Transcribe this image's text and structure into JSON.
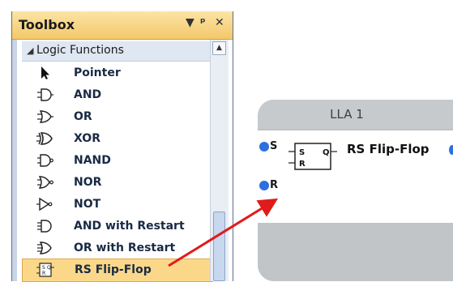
{
  "toolbox": {
    "title": "Toolbox",
    "dropdown_glyph": "▼",
    "pin_glyph": "ᵖ",
    "close_glyph": "✕",
    "category": "Logic Functions",
    "items": [
      {
        "label": "Pointer",
        "icon": "pointer-icon"
      },
      {
        "label": "AND",
        "icon": "and-gate-icon"
      },
      {
        "label": "OR",
        "icon": "or-gate-icon"
      },
      {
        "label": "XOR",
        "icon": "xor-gate-icon"
      },
      {
        "label": "NAND",
        "icon": "nand-gate-icon"
      },
      {
        "label": "NOR",
        "icon": "nor-gate-icon"
      },
      {
        "label": "NOT",
        "icon": "not-gate-icon"
      },
      {
        "label": "AND with Restart",
        "icon": "and-restart-icon"
      },
      {
        "label": "OR with Restart",
        "icon": "or-restart-icon"
      },
      {
        "label": "RS Flip-Flop",
        "icon": "rs-flipflop-icon",
        "selected": true
      }
    ]
  },
  "lla": {
    "title": "LLA 1",
    "ports": [
      "S",
      "R"
    ],
    "block_label": "RS Flip-Flop",
    "box_s": "S",
    "box_r": "R",
    "box_q": "Q"
  },
  "colors": {
    "title_bar": "#f3c86a",
    "selection": "#fbd889",
    "port": "#2f6fe0",
    "arrow": "#e01b1b"
  }
}
